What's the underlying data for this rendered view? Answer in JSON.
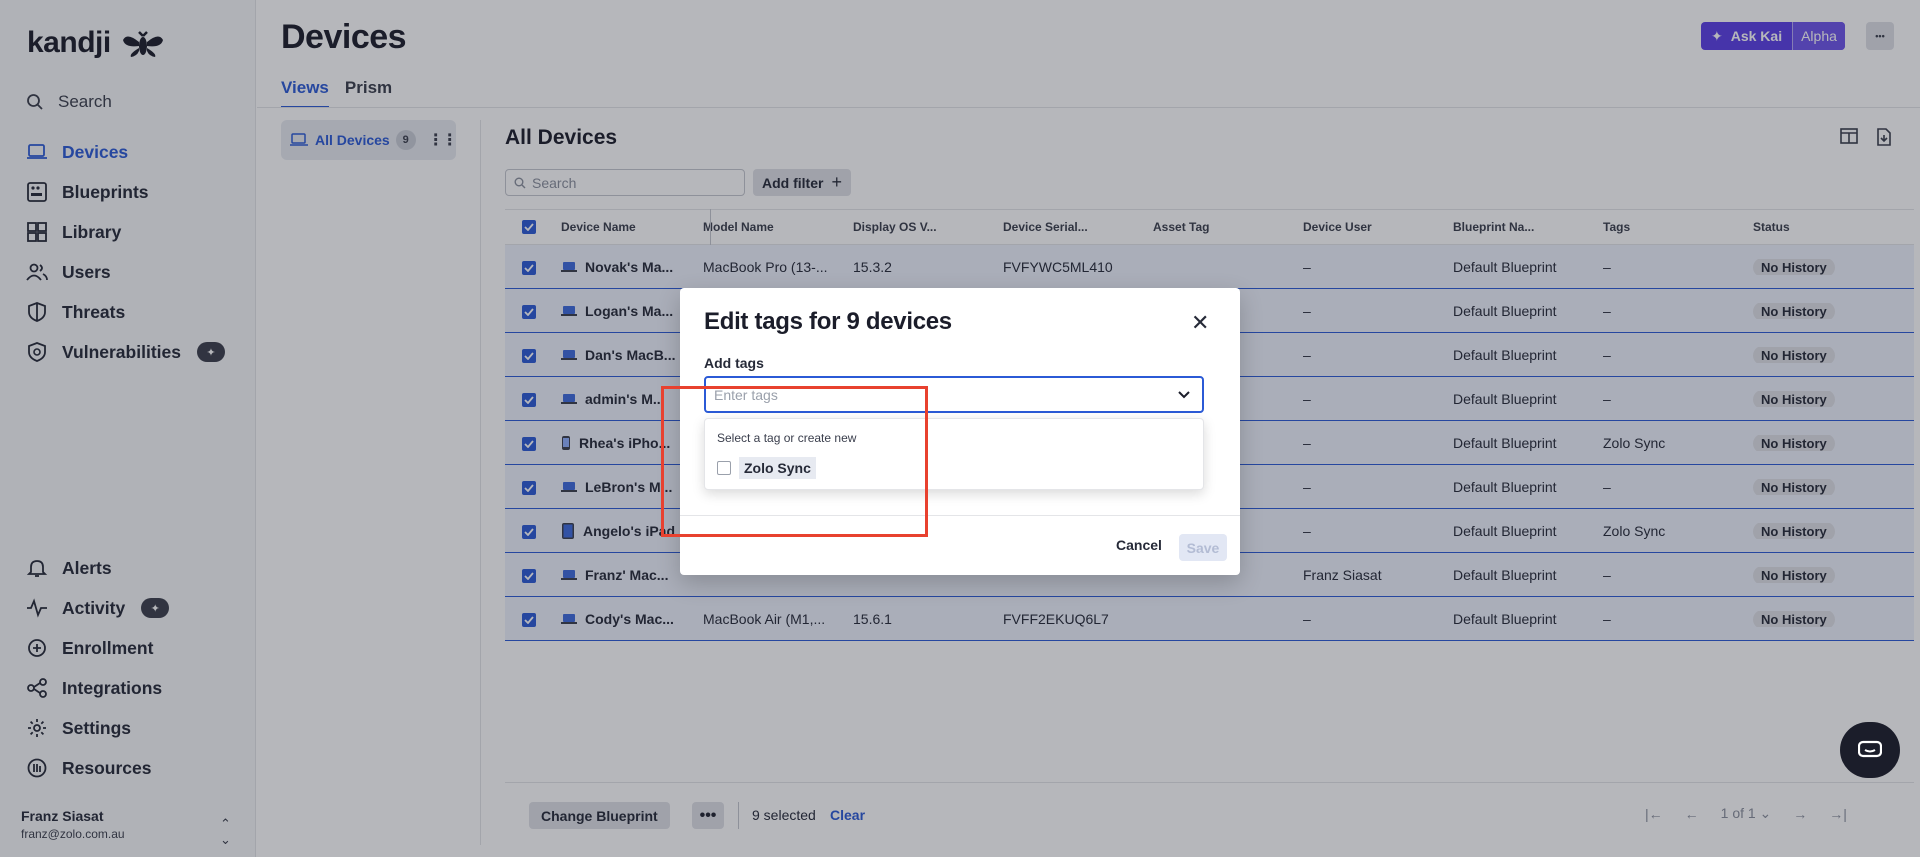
{
  "brand": {
    "logo_text": "kandji"
  },
  "sidebar": {
    "search_label": "Search",
    "items": [
      {
        "label": "Devices",
        "icon": "laptop-icon",
        "active": true
      },
      {
        "label": "Blueprints",
        "icon": "blueprint-icon"
      },
      {
        "label": "Library",
        "icon": "grid-icon"
      },
      {
        "label": "Users",
        "icon": "users-icon"
      },
      {
        "label": "Threats",
        "icon": "shield-icon"
      },
      {
        "label": "Vulnerabilities",
        "icon": "shield-check-icon"
      }
    ],
    "bottom_items": [
      {
        "label": "Alerts",
        "icon": "bell-icon"
      },
      {
        "label": "Activity",
        "icon": "activity-icon"
      },
      {
        "label": "Enrollment",
        "icon": "plus-circle-icon"
      },
      {
        "label": "Integrations",
        "icon": "share-icon"
      },
      {
        "label": "Settings",
        "icon": "gear-icon"
      },
      {
        "label": "Resources",
        "icon": "resources-icon"
      }
    ],
    "user": {
      "name": "Franz Siasat",
      "email": "franz@zolo.com.au"
    }
  },
  "header": {
    "title": "Devices",
    "tabs": [
      {
        "label": "Views",
        "active": true
      },
      {
        "label": "Prism"
      }
    ],
    "ask_kai": "Ask Kai",
    "alpha": "Alpha",
    "more": "•••"
  },
  "views": {
    "all_devices_label": "All Devices",
    "count": "9"
  },
  "content": {
    "title": "All Devices",
    "search_placeholder": "Search",
    "add_filter": "Add filter"
  },
  "table": {
    "columns": [
      "Device Name",
      "Model Name",
      "Display OS V...",
      "Device Serial...",
      "Asset Tag",
      "Device User",
      "Blueprint Na...",
      "Tags",
      "Status"
    ],
    "rows": [
      {
        "name": "Novak's Ma...",
        "model": "MacBook Pro (13-...",
        "os": "15.3.2",
        "serial": "FVFYWC5ML410",
        "asset": "",
        "user": "–",
        "blueprint": "Default Blueprint",
        "tags": "–",
        "status": "No History",
        "device": "laptop"
      },
      {
        "name": "Logan's Ma...",
        "model": "",
        "os": "",
        "serial": "",
        "asset": "",
        "user": "–",
        "blueprint": "Default Blueprint",
        "tags": "–",
        "status": "No History",
        "device": "laptop"
      },
      {
        "name": "Dan's MacB...",
        "model": "",
        "os": "",
        "serial": "",
        "asset": "",
        "user": "–",
        "blueprint": "Default Blueprint",
        "tags": "–",
        "status": "No History",
        "device": "laptop"
      },
      {
        "name": "admin's M...",
        "model": "",
        "os": "",
        "serial": "",
        "asset": "",
        "user": "–",
        "blueprint": "Default Blueprint",
        "tags": "–",
        "status": "No History",
        "device": "laptop"
      },
      {
        "name": "Rhea's iPho...",
        "model": "",
        "os": "",
        "serial": "",
        "asset": "",
        "user": "–",
        "blueprint": "Default Blueprint",
        "tags": "Zolo Sync",
        "status": "No History",
        "device": "phone"
      },
      {
        "name": "LeBron's M...",
        "model": "",
        "os": "",
        "serial": "",
        "asset": "",
        "user": "–",
        "blueprint": "Default Blueprint",
        "tags": "–",
        "status": "No History",
        "device": "laptop"
      },
      {
        "name": "Angelo's iPad",
        "model": "",
        "os": "",
        "serial": "",
        "asset": "",
        "user": "–",
        "blueprint": "Default Blueprint",
        "tags": "Zolo Sync",
        "status": "No History",
        "device": "tablet"
      },
      {
        "name": "Franz' Mac...",
        "model": "",
        "os": "",
        "serial": "",
        "asset": "",
        "user": "Franz Siasat",
        "blueprint": "Default Blueprint",
        "tags": "–",
        "status": "No History",
        "device": "laptop"
      },
      {
        "name": "Cody's Mac...",
        "model": "MacBook Air (M1,...",
        "os": "15.6.1",
        "serial": "FVFF2EKUQ6L7",
        "asset": "",
        "user": "–",
        "blueprint": "Default Blueprint",
        "tags": "–",
        "status": "No History",
        "device": "laptop"
      }
    ]
  },
  "footer": {
    "change_blueprint": "Change Blueprint",
    "selected_text": "9 selected",
    "clear": "Clear",
    "page": "1 of 1"
  },
  "modal": {
    "title": "Edit tags for 9 devices",
    "add_tags_label": "Add tags",
    "input_placeholder": "Enter tags",
    "dropdown_hint": "Select a tag or create new",
    "dropdown_option": "Zolo Sync",
    "cancel": "Cancel",
    "save": "Save"
  },
  "colors": {
    "accent": "#2b5ad6",
    "kai": "#5b3ee6",
    "highlight": "#e8412f"
  }
}
